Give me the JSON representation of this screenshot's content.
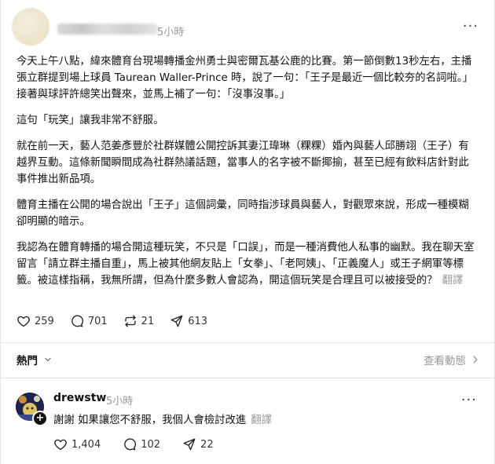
{
  "post": {
    "time": "5小時",
    "more_label": "···",
    "paragraphs": [
      "今天上午八點，緯來體育台現場轉播金州勇士與密爾瓦基公鹿的比賽。第一節倒數13秒左右，主播張立群提到場上球員 Taurean Waller-Prince 時，說了一句：「王子是最近一個比較夯的名詞啦。」接著與球評許總笑出聲來，並馬上補了一句：「沒事沒事。」",
      "這句「玩笑」讓我非常不舒服。",
      "就在前一天，藝人范姜彥豐於社群媒體公開控訴其妻江瑋琳（粿粿）婚內與藝人邱勝翊（王子）有越界互動。這條新聞瞬間成為社群熱議話題，當事人的名字被不斷揶揄，甚至已經有飲料店針對此事件推出新品項。",
      "體育主播在公開的場合說出「王子」這個詞彙，同時指涉球員與藝人，對觀眾來說，形成一種模糊卻明顯的暗示。",
      "我認為在體育轉播的場合開這種玩笑，不只是「口誤」，而是一種消費他人私事的幽默。我在聊天室留言「請立群主播自重」，馬上被其他網友貼上「女拳」、「老阿姨」、「正義魔人」或王子網軍等標籤。被這樣指稱，我無所謂，但為什麼多數人會認為，開這個玩笑是合理且可以被接受的？"
    ],
    "translate_label": "翻譯",
    "likes": "259",
    "comments": "701",
    "reposts": "21",
    "shares": "613"
  },
  "sort": {
    "label": "熱門",
    "view_activity": "查看動態"
  },
  "reply": {
    "username": "drewstw",
    "time": "5小時",
    "more_label": "···",
    "text": "謝謝 如果讓您不舒服，我個人會檢討改進",
    "translate_label": "翻譯",
    "likes": "1,404",
    "comments": "102",
    "shares": "22",
    "follow_label": "+"
  }
}
